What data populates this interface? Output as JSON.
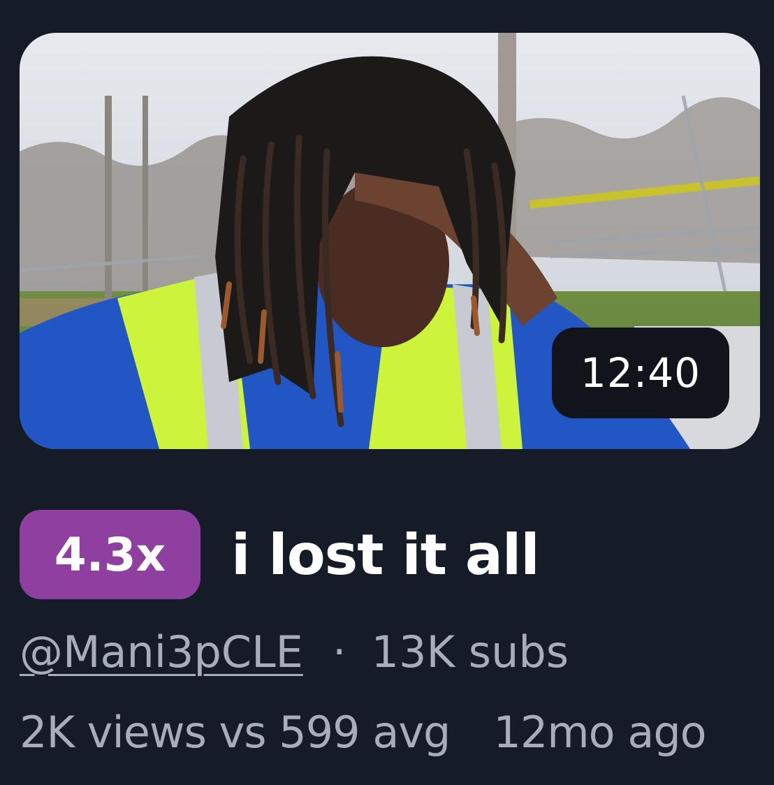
{
  "video": {
    "duration": "12:40",
    "title": "i lost it all",
    "outlier_multiplier": "4.3x"
  },
  "channel": {
    "handle": "@Mani3pCLE",
    "separator": "·",
    "subscribers": "13K subs"
  },
  "stats": {
    "views_vs_avg": "2K views vs 599 avg",
    "age": "12mo ago"
  },
  "colors": {
    "background": "#151b27",
    "badge": "#8e3f9f",
    "muted_text": "#a9adb8",
    "duration_bg": "#11141a"
  }
}
